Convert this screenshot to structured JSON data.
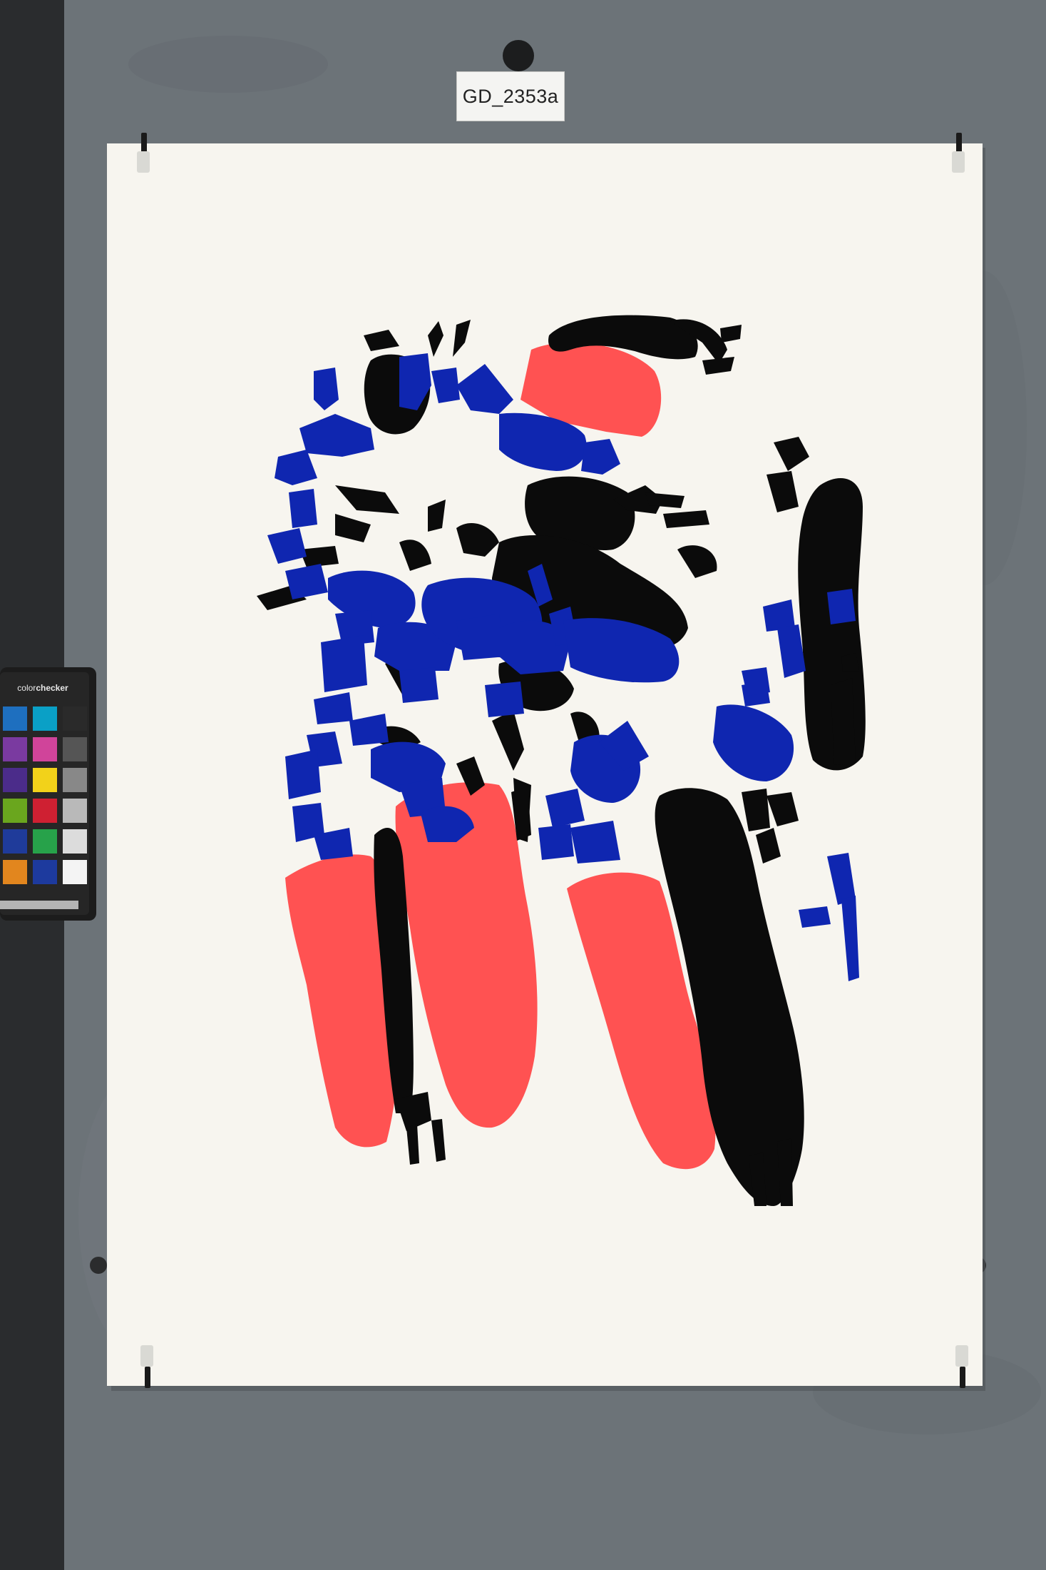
{
  "specimen_label": "GD_2353a",
  "color_checker": {
    "brand_prefix": "color",
    "brand_suffix": "checker",
    "patch_colors": [
      [
        "#1e6fbf",
        "#0aa0c6",
        "#2a2a2a"
      ],
      [
        "#7a3aa0",
        "#d0449a",
        "#555555"
      ],
      [
        "#4b2c8a",
        "#f2d21a",
        "#888888"
      ],
      [
        "#6aa61e",
        "#cf2032",
        "#b9b9b9"
      ],
      [
        "#1f3b9a",
        "#27a24a",
        "#dcdcdc"
      ],
      [
        "#e2861e",
        "#1d3a9e",
        "#f4f4f4"
      ]
    ]
  },
  "palette": {
    "background": "#6c7378",
    "paper": "#f7f5ef",
    "ink_black": "#0b0b0b",
    "ink_blue": "#0f26b0",
    "ink_red": "#ff5252"
  }
}
